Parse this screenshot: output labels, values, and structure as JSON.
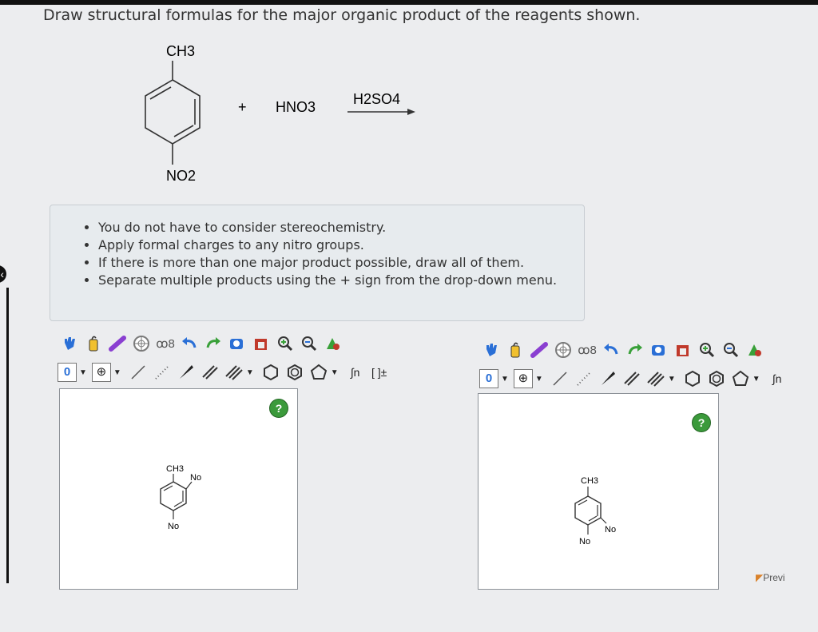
{
  "question": {
    "title": "Draw structural formulas for the major organic product of the reagents shown."
  },
  "reaction": {
    "substituent_top": "CH3",
    "substituent_bottom": "NO2",
    "plus": "+",
    "reagent": "HNO3",
    "catalyst": "H2SO4"
  },
  "instructions": {
    "items": [
      "You do not have to consider stereochemistry.",
      "Apply formal charges to any nitro groups.",
      "If there is more than one major product possible, draw all of them.",
      "Separate multiple products using the + sign from the drop-down menu."
    ]
  },
  "editors": [
    {
      "charge_value": "0",
      "plus_value": "⊕",
      "extra_tools": [
        "∫n",
        "[ ]±"
      ],
      "help_label": "?",
      "drawing": {
        "top": "CH3",
        "right": "No",
        "bottom": "No"
      }
    },
    {
      "charge_value": "0",
      "plus_value": "⊕",
      "extra_tools": [
        "∫n"
      ],
      "help_label": "?",
      "drawing": {
        "top": "CH3",
        "right": "No",
        "bottom": "No"
      }
    }
  ],
  "footer": {
    "previous_label": "Previ"
  },
  "colors": {
    "help_green": "#3b9a3b",
    "tool_blue": "#2a6fd6",
    "tool_purple": "#8a3fd1"
  }
}
